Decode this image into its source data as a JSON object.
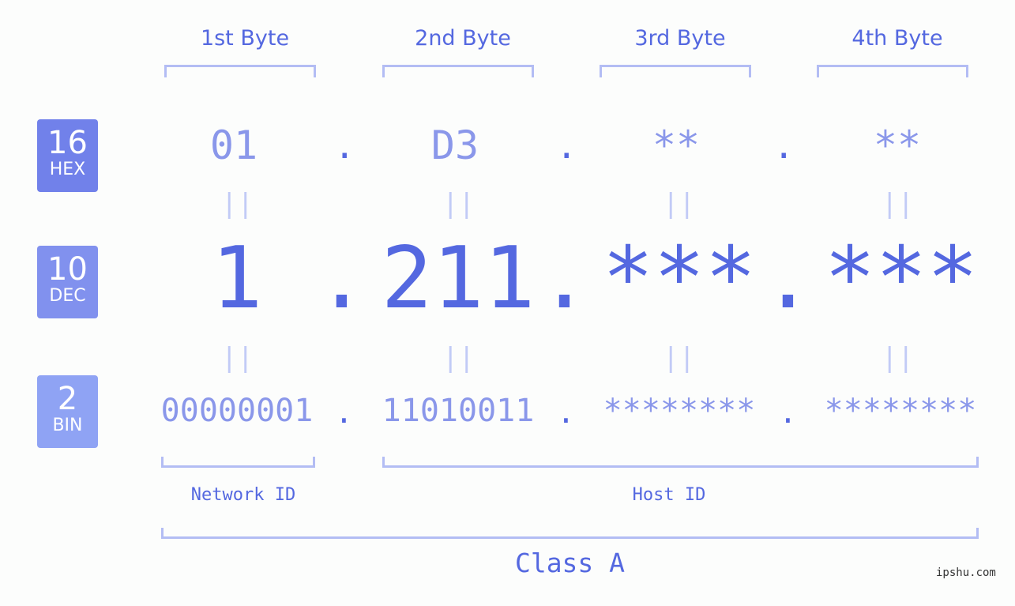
{
  "badges": [
    {
      "number": "16",
      "label": "HEX",
      "color": "#7181ea"
    },
    {
      "number": "10",
      "label": "DEC",
      "color": "#8191ee"
    },
    {
      "number": "2",
      "label": "BIN",
      "color": "#8fa3f4"
    }
  ],
  "bytes": [
    {
      "header": "1st Byte",
      "hex": "01",
      "dec": "1",
      "bin": "00000001"
    },
    {
      "header": "2nd Byte",
      "hex": "D3",
      "dec": "211",
      "bin": "11010011"
    },
    {
      "header": "3rd Byte",
      "hex": "**",
      "dec": "***",
      "bin": "********"
    },
    {
      "header": "4th Byte",
      "hex": "**",
      "dec": "***",
      "bin": "********"
    }
  ],
  "separator": ".",
  "equals": "||",
  "network_id_label": "Network ID",
  "host_id_label": "Host ID",
  "class_label": "Class A",
  "watermark": "ipshu.com",
  "colors": {
    "accent": "#5468e0",
    "light": "#8a97ea",
    "bracket": "#b3bdf4"
  }
}
